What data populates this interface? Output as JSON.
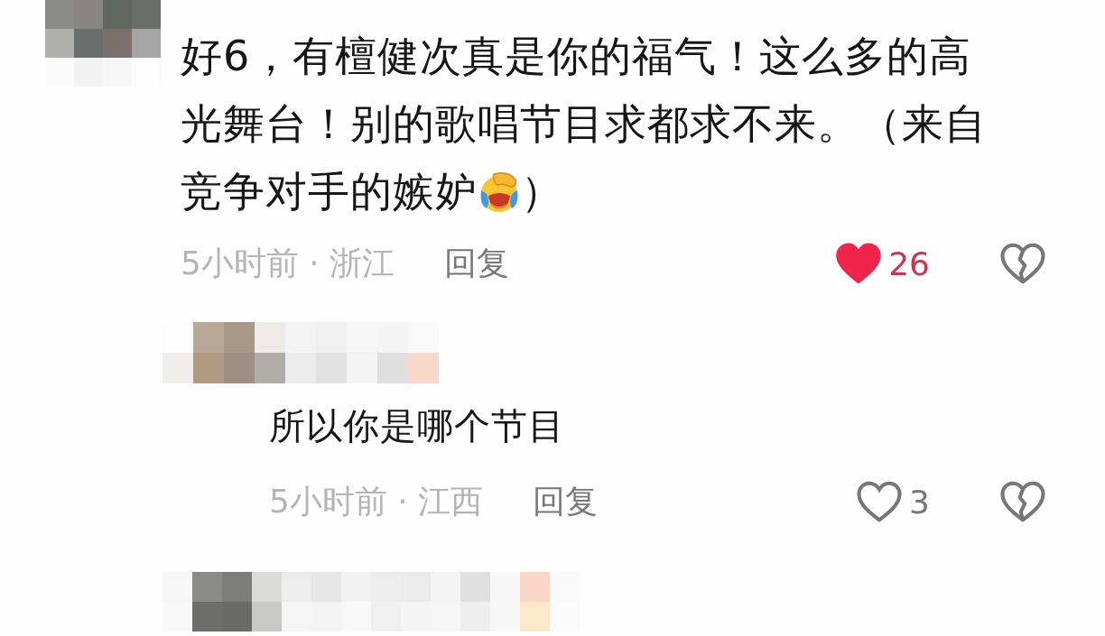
{
  "comments": [
    {
      "lines": [
        [
          {
            "kind": "text",
            "text": "好6，有檀健次真是你的福气！这么多的高"
          }
        ],
        [
          {
            "kind": "text",
            "text": "光舞台！别的歌唱节目求都求不来。（来自"
          }
        ],
        [
          {
            "kind": "text",
            "text": "竞争对手的嫉妒"
          },
          {
            "kind": "emoji"
          },
          {
            "kind": "text",
            "text": "）"
          }
        ]
      ],
      "meta": "5小时前 · 浙江",
      "reply_label": "回复",
      "liked": true,
      "likes": "26",
      "replies": [
        {
          "lines": [
            [
              {
                "kind": "text",
                "text": "所以你是哪个节目"
              }
            ]
          ],
          "meta": "5小时前 · 江西",
          "reply_label": "回复",
          "liked": false,
          "likes": "3"
        }
      ]
    }
  ]
}
